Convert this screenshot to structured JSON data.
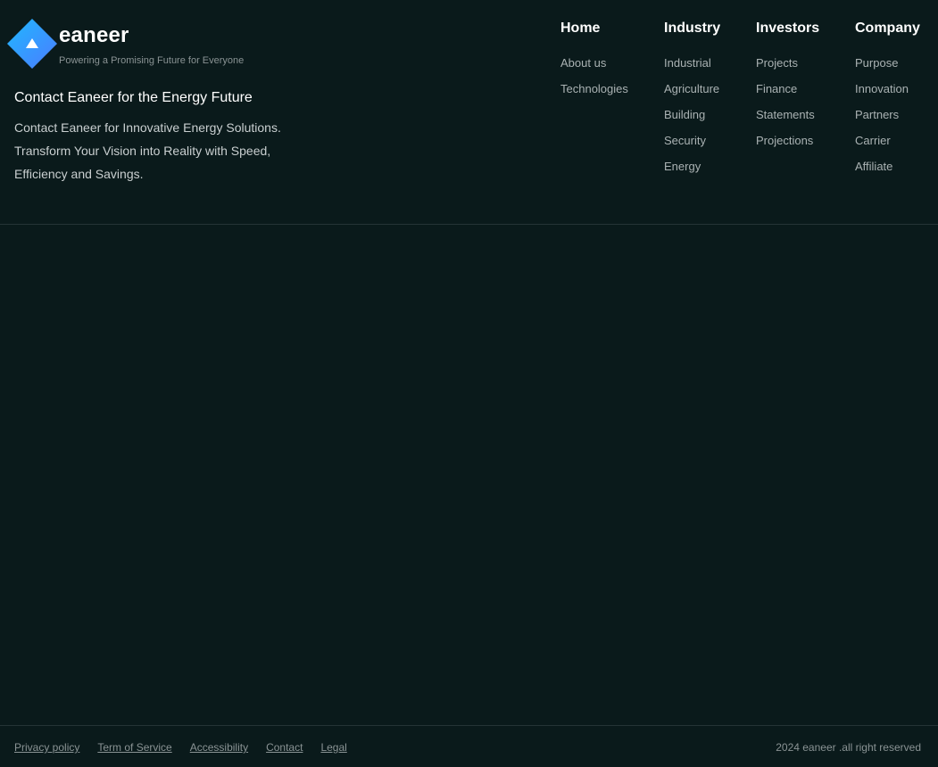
{
  "brand": {
    "name": "eaneer",
    "tagline": "Powering a Promising Future for Everyone",
    "logo_icon": "diamond-triangle-logo",
    "gradient_start": "#1fb8ff",
    "gradient_end": "#4c7cff"
  },
  "contact": {
    "title": "Contact Eaneer for the Energy Future",
    "text": "Contact Eaneer for Innovative Energy Solutions. Transform Your Vision into Reality with Speed, Efficiency and Savings."
  },
  "nav": {
    "home": {
      "heading": "Home",
      "links": [
        "About us",
        "Technologies"
      ]
    },
    "industry": {
      "heading": "Industry",
      "links": [
        "Industrial",
        "Agriculture",
        "Building",
        "Security",
        "Energy"
      ]
    },
    "investors": {
      "heading": "Investors",
      "links": [
        "Projects",
        "Finance",
        "Statements",
        "Projections"
      ]
    },
    "company": {
      "heading": "Company",
      "links": [
        "Purpose",
        "Innovation",
        "Partners",
        "Carrier",
        "Affiliate"
      ]
    }
  },
  "footer": {
    "legal_links": [
      "Privacy policy",
      "Term of Service",
      "Accessibility",
      "Contact",
      "Legal"
    ],
    "copyright": "2024 eaneer .all right reserved"
  },
  "colors": {
    "background": "#0a1a1b",
    "divider": "#253436",
    "muted_text": "#8a9394"
  }
}
